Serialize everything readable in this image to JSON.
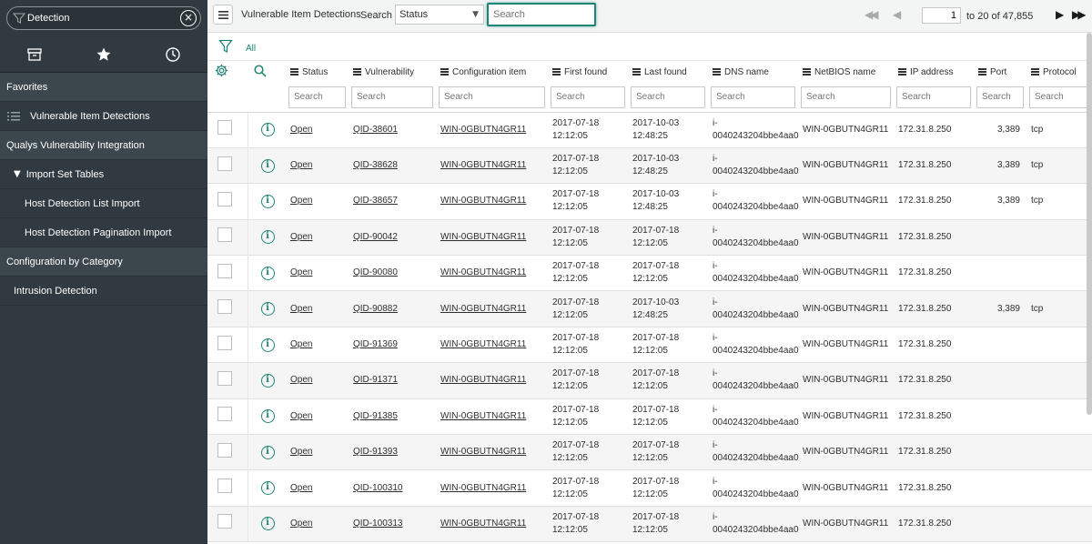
{
  "sidebar": {
    "filter_value": "Detection",
    "clear_glyph": "×",
    "tabs": [
      {
        "icon": "archive-icon"
      },
      {
        "icon": "star-icon"
      },
      {
        "icon": "history-clock-icon"
      }
    ],
    "nav": {
      "favorites": "Favorites",
      "vuln_item_detections": "Vulnerable Item Detections",
      "qualys": "Qualys Vulnerability Integration",
      "import_set_tables": "Import Set Tables",
      "triangle": "▼",
      "host_detection_list_import": "Host Detection List Import",
      "host_detection_pagination_import": "Host Detection Pagination Import",
      "config_by_category": "Configuration by Category",
      "intrusion_detection": "Intrusion Detection"
    }
  },
  "header": {
    "title": "Vulnerable Item Detections",
    "search_label": "Search",
    "field_select": "Status",
    "search_placeholder": "Search",
    "pager": {
      "first": "◀◀",
      "prev": "◀",
      "page": "1",
      "of_text": "to 20 of 47,855",
      "next": "▶",
      "last": "▶▶"
    }
  },
  "breadcrumb": {
    "all": "All"
  },
  "table": {
    "columns": {
      "status": "Status",
      "vulnerability": "Vulnerability",
      "configuration_item": "Configuration item",
      "first_found": "First found",
      "last_found": "Last found",
      "dns_name": "DNS name",
      "netbios_name": "NetBIOS name",
      "ip_address": "IP address",
      "port": "Port",
      "protocol": "Protocol"
    },
    "search_placeholder": "Search",
    "info_glyph": "i",
    "rows": [
      {
        "status": "Open",
        "vuln": "QID-38601",
        "ci": "WIN-0GBUTN4GR11",
        "ff_date": "2017-07-18",
        "ff_time": "12:12:05",
        "lf_date": "2017-10-03",
        "lf_time": "12:48:25",
        "dns1": "i-",
        "dns2": "0040243204bbe4aa0",
        "netbios": "WIN-0GBUTN4GR11",
        "ip": "172.31.8.250",
        "port": "3,389",
        "protocol": "tcp"
      },
      {
        "status": "Open",
        "vuln": "QID-38628",
        "ci": "WIN-0GBUTN4GR11",
        "ff_date": "2017-07-18",
        "ff_time": "12:12:05",
        "lf_date": "2017-10-03",
        "lf_time": "12:48:25",
        "dns1": "i-",
        "dns2": "0040243204bbe4aa0",
        "netbios": "WIN-0GBUTN4GR11",
        "ip": "172.31.8.250",
        "port": "3,389",
        "protocol": "tcp"
      },
      {
        "status": "Open",
        "vuln": "QID-38657",
        "ci": "WIN-0GBUTN4GR11",
        "ff_date": "2017-07-18",
        "ff_time": "12:12:05",
        "lf_date": "2017-10-03",
        "lf_time": "12:48:25",
        "dns1": "i-",
        "dns2": "0040243204bbe4aa0",
        "netbios": "WIN-0GBUTN4GR11",
        "ip": "172.31.8.250",
        "port": "3,389",
        "protocol": "tcp"
      },
      {
        "status": "Open",
        "vuln": "QID-90042",
        "ci": "WIN-0GBUTN4GR11",
        "ff_date": "2017-07-18",
        "ff_time": "12:12:05",
        "lf_date": "2017-07-18",
        "lf_time": "12:12:05",
        "dns1": "i-",
        "dns2": "0040243204bbe4aa0",
        "netbios": "WIN-0GBUTN4GR11",
        "ip": "172.31.8.250",
        "port": "",
        "protocol": ""
      },
      {
        "status": "Open",
        "vuln": "QID-90080",
        "ci": "WIN-0GBUTN4GR11",
        "ff_date": "2017-07-18",
        "ff_time": "12:12:05",
        "lf_date": "2017-07-18",
        "lf_time": "12:12:05",
        "dns1": "i-",
        "dns2": "0040243204bbe4aa0",
        "netbios": "WIN-0GBUTN4GR11",
        "ip": "172.31.8.250",
        "port": "",
        "protocol": ""
      },
      {
        "status": "Open",
        "vuln": "QID-90882",
        "ci": "WIN-0GBUTN4GR11",
        "ff_date": "2017-07-18",
        "ff_time": "12:12:05",
        "lf_date": "2017-10-03",
        "lf_time": "12:48:25",
        "dns1": "i-",
        "dns2": "0040243204bbe4aa0",
        "netbios": "WIN-0GBUTN4GR11",
        "ip": "172.31.8.250",
        "port": "3,389",
        "protocol": "tcp"
      },
      {
        "status": "Open",
        "vuln": "QID-91369",
        "ci": "WIN-0GBUTN4GR11",
        "ff_date": "2017-07-18",
        "ff_time": "12:12:05",
        "lf_date": "2017-07-18",
        "lf_time": "12:12:05",
        "dns1": "i-",
        "dns2": "0040243204bbe4aa0",
        "netbios": "WIN-0GBUTN4GR11",
        "ip": "172.31.8.250",
        "port": "",
        "protocol": ""
      },
      {
        "status": "Open",
        "vuln": "QID-91371",
        "ci": "WIN-0GBUTN4GR11",
        "ff_date": "2017-07-18",
        "ff_time": "12:12:05",
        "lf_date": "2017-07-18",
        "lf_time": "12:12:05",
        "dns1": "i-",
        "dns2": "0040243204bbe4aa0",
        "netbios": "WIN-0GBUTN4GR11",
        "ip": "172.31.8.250",
        "port": "",
        "protocol": ""
      },
      {
        "status": "Open",
        "vuln": "QID-91385",
        "ci": "WIN-0GBUTN4GR11",
        "ff_date": "2017-07-18",
        "ff_time": "12:12:05",
        "lf_date": "2017-07-18",
        "lf_time": "12:12:05",
        "dns1": "i-",
        "dns2": "0040243204bbe4aa0",
        "netbios": "WIN-0GBUTN4GR11",
        "ip": "172.31.8.250",
        "port": "",
        "protocol": ""
      },
      {
        "status": "Open",
        "vuln": "QID-91393",
        "ci": "WIN-0GBUTN4GR11",
        "ff_date": "2017-07-18",
        "ff_time": "12:12:05",
        "lf_date": "2017-07-18",
        "lf_time": "12:12:05",
        "dns1": "i-",
        "dns2": "0040243204bbe4aa0",
        "netbios": "WIN-0GBUTN4GR11",
        "ip": "172.31.8.250",
        "port": "",
        "protocol": ""
      },
      {
        "status": "Open",
        "vuln": "QID-100310",
        "ci": "WIN-0GBUTN4GR11",
        "ff_date": "2017-07-18",
        "ff_time": "12:12:05",
        "lf_date": "2017-07-18",
        "lf_time": "12:12:05",
        "dns1": "i-",
        "dns2": "0040243204bbe4aa0",
        "netbios": "WIN-0GBUTN4GR11",
        "ip": "172.31.8.250",
        "port": "",
        "protocol": ""
      },
      {
        "status": "Open",
        "vuln": "QID-100313",
        "ci": "WIN-0GBUTN4GR11",
        "ff_date": "2017-07-18",
        "ff_time": "12:12:05",
        "lf_date": "2017-07-18",
        "lf_time": "12:12:05",
        "dns1": "i-",
        "dns2": "0040243204bbe4aa0",
        "netbios": "WIN-0GBUTN4GR11",
        "ip": "172.31.8.250",
        "port": "",
        "protocol": ""
      }
    ]
  },
  "colors": {
    "sidebar_bg": "#303a40",
    "accent_teal": "#1f8476",
    "header_bg": "#f3f4f4"
  }
}
